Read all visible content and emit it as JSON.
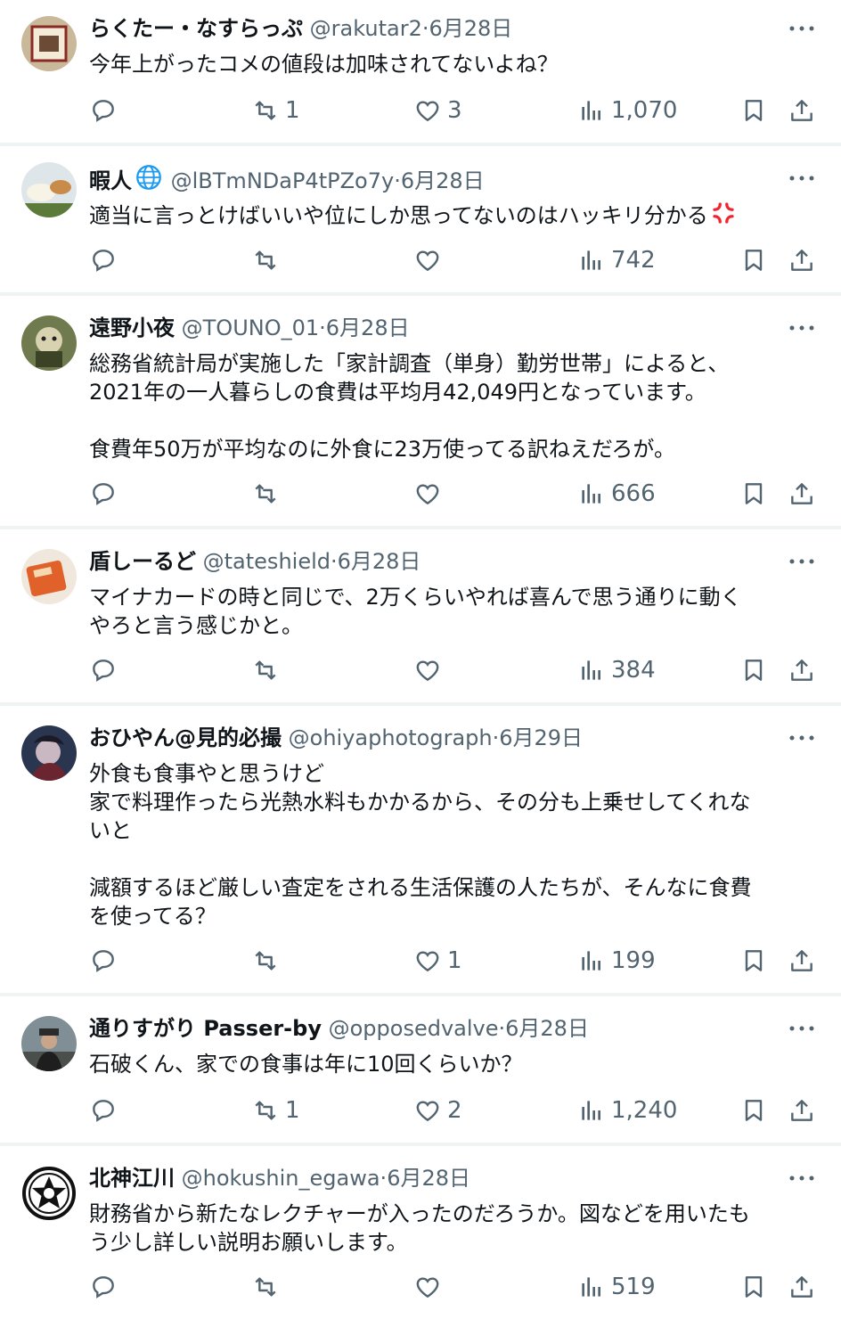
{
  "tweets": [
    {
      "name": "らくたー・なすらっぷ",
      "handle": "@rakutar2",
      "dot": "·",
      "date": "6月28日",
      "text": "今年上がったコメの値段は加味されてないよね？",
      "counts": {
        "reply": "",
        "retweet": "1",
        "like": "3",
        "views": "1,070"
      }
    },
    {
      "name": "暇人",
      "name_badge": "globe-icon",
      "handle": "@lBTmNDaP4tPZo7y",
      "dot": "·",
      "date": "6月28日",
      "text": "適当に言っとけばいいや位にしか思ってないのはハッキリ分かる",
      "text_emoji": "anger-icon",
      "counts": {
        "reply": "",
        "retweet": "",
        "like": "",
        "views": "742"
      }
    },
    {
      "name": "遠野小夜",
      "handle": "@TOUNO_01",
      "dot": "·",
      "date": "6月28日",
      "text": "総務省統計局が実施した「家計調査（単身）勤労世帯」によると、\n2021年の一人暮らしの食費は平均月42,049円となっています。\n\n食費年50万が平均なのに外食に23万使ってる訳ねえだろが。",
      "counts": {
        "reply": "",
        "retweet": "",
        "like": "",
        "views": "666"
      }
    },
    {
      "name": "盾しーるど",
      "handle": "@tateshield",
      "dot": "·",
      "date": "6月28日",
      "text": "マイナカードの時と同じで、2万くらいやれば喜んで思う通りに動く\nやろと言う感じかと。",
      "counts": {
        "reply": "",
        "retweet": "",
        "like": "",
        "views": "384"
      }
    },
    {
      "name": "おひやん@見的必撮",
      "handle": "@ohiyaphotograph",
      "dot": "·",
      "date": "6月29日",
      "text": "外食も食事やと思うけど\n家で料理作ったら光熱水料もかかるから、その分も上乗せしてくれな\nいと\n\n減額するほど厳しい査定をされる生活保護の人たちが、そんなに食費\nを使ってる？",
      "counts": {
        "reply": "",
        "retweet": "",
        "like": "1",
        "views": "199"
      }
    },
    {
      "name": "通りすがり Passer-by",
      "handle": "@opposedvalve",
      "dot": "·",
      "date": "6月28日",
      "text": "石破くん、家での食事は年に10回くらいか？",
      "counts": {
        "reply": "",
        "retweet": "1",
        "like": "2",
        "views": "1,240"
      }
    },
    {
      "name": "北神江川",
      "handle": "@hokushin_egawa",
      "dot": "·",
      "date": "6月28日",
      "text": "財務省から新たなレクチャーが入ったのだろうか。図などを用いたも\nう少し詳しい説明お願いします。",
      "counts": {
        "reply": "",
        "retweet": "",
        "like": "",
        "views": "519"
      }
    }
  ],
  "icons": [
    "reply-icon",
    "retweet-icon",
    "like-icon",
    "views-icon",
    "bookmark-icon",
    "share-icon",
    "more-icon"
  ],
  "colors": {
    "text": "#0f1419",
    "secondary": "#536471",
    "separator": "#eff3f4",
    "badge": "#1d9bf0",
    "anger": "#f4212e"
  }
}
